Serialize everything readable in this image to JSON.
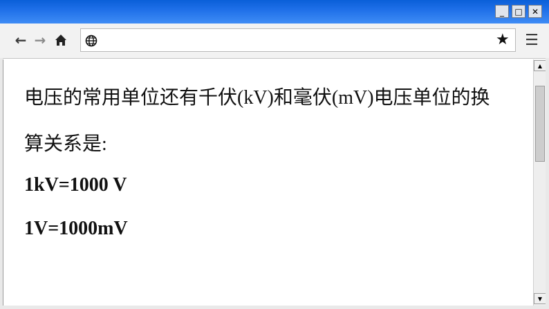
{
  "window": {
    "controls": {
      "minimize": "_",
      "maximize": "□",
      "close": "✕"
    }
  },
  "toolbar": {
    "back_icon": "←",
    "forward_icon": "→",
    "home_icon": "⌂",
    "address": {
      "value": "",
      "globe_icon": "globe-icon"
    },
    "bookmark_icon": "★",
    "menu_icon": "☰"
  },
  "page": {
    "paragraph_line1": "电压的常用单位还有千伏(kV)和毫伏(mV)电压单位的换",
    "paragraph_line2": "算关系是:",
    "formula1": "1kV=1000 V",
    "formula2": "1V=1000mV"
  },
  "scrollbar": {
    "up_arrow": "▲",
    "down_arrow": "▼"
  }
}
